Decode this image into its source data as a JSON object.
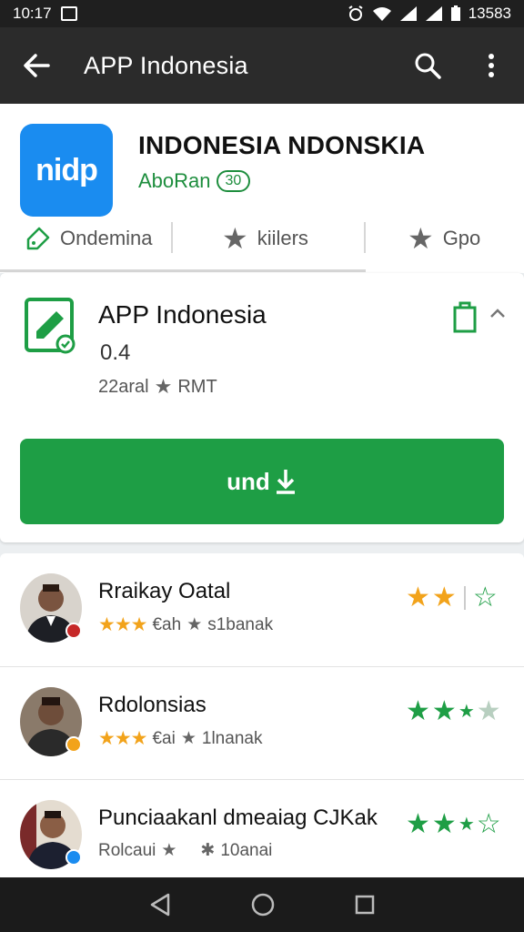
{
  "status_bar": {
    "time": "10:17",
    "battery_text": "13583"
  },
  "app_bar": {
    "title": "APP Indonesia",
    "back_icon": "arrow-left-icon",
    "search_icon": "search-icon",
    "menu_icon": "more-vert-icon"
  },
  "header": {
    "app_name": "INDONESIA NDONSKIA",
    "icon_text": "nidp",
    "developer": "AboRan",
    "badge": "30",
    "tabs": [
      {
        "label": "Ondemina",
        "icon": "tag-icon"
      },
      {
        "label": "kiilers",
        "icon": "star-icon"
      },
      {
        "label": "Gpo",
        "icon": "star-icon"
      }
    ]
  },
  "install_card": {
    "title": "APP Indonesia",
    "version": "0.4",
    "meta_left": "22aral",
    "meta_right": "RMT",
    "button_label": "und"
  },
  "reviews": [
    {
      "name": "Rraikay Oatal",
      "sub_a": "€ah",
      "sub_b": "s1banak",
      "yellow_stars": 3,
      "right_style": "yellow"
    },
    {
      "name": "Rdolonsias",
      "sub_a": "€ai",
      "sub_b": "1lnanak",
      "yellow_stars": 3,
      "right_style": "green"
    },
    {
      "name": "Punciaakanl dmeaiag CJKak",
      "sub_a": "Rolcaui",
      "sub_b": "10anai",
      "yellow_stars": 0,
      "right_style": "green"
    }
  ],
  "colors": {
    "accent_green": "#1e9e45",
    "app_bar": "#2b2b2b",
    "app_icon_blue": "#1a8cf0",
    "star_yellow": "#f2a31b"
  }
}
